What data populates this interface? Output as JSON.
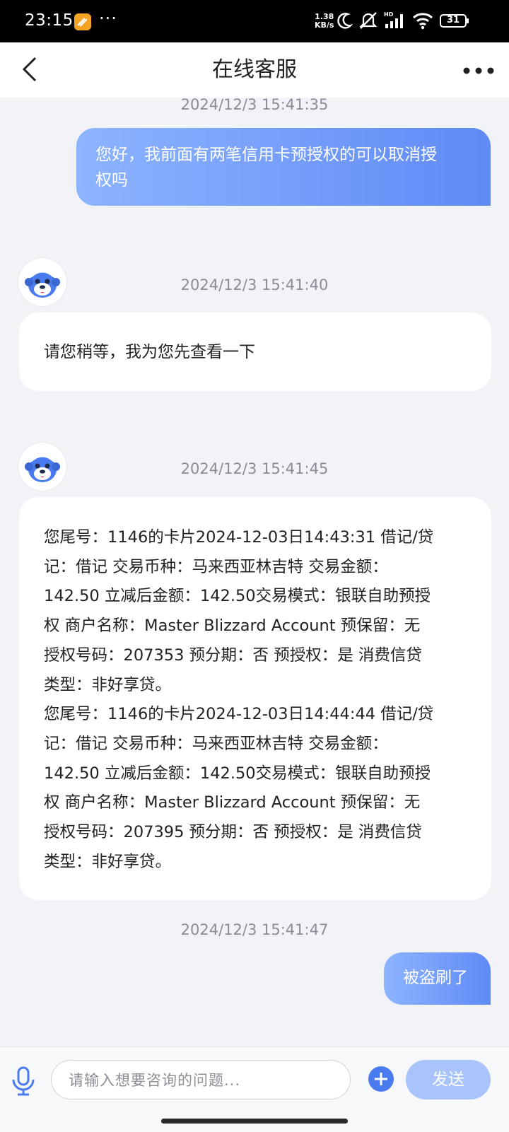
{
  "status_bar": {
    "time": "23:15",
    "more": "···",
    "net_speed_value": "1.38",
    "net_speed_unit": "KB/s",
    "battery": "31",
    "icons": [
      "app-notification-icon",
      "moon-icon",
      "mute-icon",
      "hd-signal-icon",
      "wifi-icon",
      "battery-icon"
    ]
  },
  "nav": {
    "title": "在线客服",
    "back_icon": "chevron-left-icon",
    "more_icon": "more-dots-icon"
  },
  "messages": [
    {
      "role": "user",
      "time": "2024/12/3 15:41:35",
      "lines": [
        "您好，我前面有两笔信用卡预授权的可以取消授",
        "权吗"
      ]
    },
    {
      "role": "bot",
      "time": "2024/12/3 15:41:40",
      "lines": [
        "请您稍等，我为您先查看一下"
      ]
    },
    {
      "role": "bot",
      "time": "2024/12/3 15:41:45",
      "lines": [
        "您尾号：1146的卡片2024-12-03日14:43:31 借记/贷",
        "记：借记 交易币种：马来西亚林吉特 交易金额：",
        "142.50 立减后金额：142.50交易模式：银联自助预授",
        "权 商户名称：Master Blizzard Account 预保留：无",
        "授权号码：207353 预分期：否 预授权：是 消费信贷",
        "类型：非好享贷。",
        "您尾号：1146的卡片2024-12-03日14:44:44 借记/贷",
        "记：借记 交易币种：马来西亚林吉特 交易金额：",
        "142.50 立减后金额：142.50交易模式：银联自助预授",
        "权 商户名称：Master Blizzard Account 预保留：无",
        "授权号码：207395 预分期：否 预授权：是 消费信贷",
        "类型：非好享贷。"
      ]
    },
    {
      "role": "user",
      "time": "2024/12/3 15:41:47",
      "lines": [
        "被盗刷了"
      ]
    }
  ],
  "input_bar": {
    "placeholder": "请输入想要咨询的问题...",
    "send_label": "发送",
    "mic_icon": "microphone-icon",
    "plus_icon": "plus-circle-icon"
  },
  "colors": {
    "user_bubble_start": "#8db4ff",
    "user_bubble_end": "#5f8af5",
    "send_button": "#a9c4fb",
    "accent_blue": "#4a7cf0",
    "background": "#f2f3f7"
  }
}
